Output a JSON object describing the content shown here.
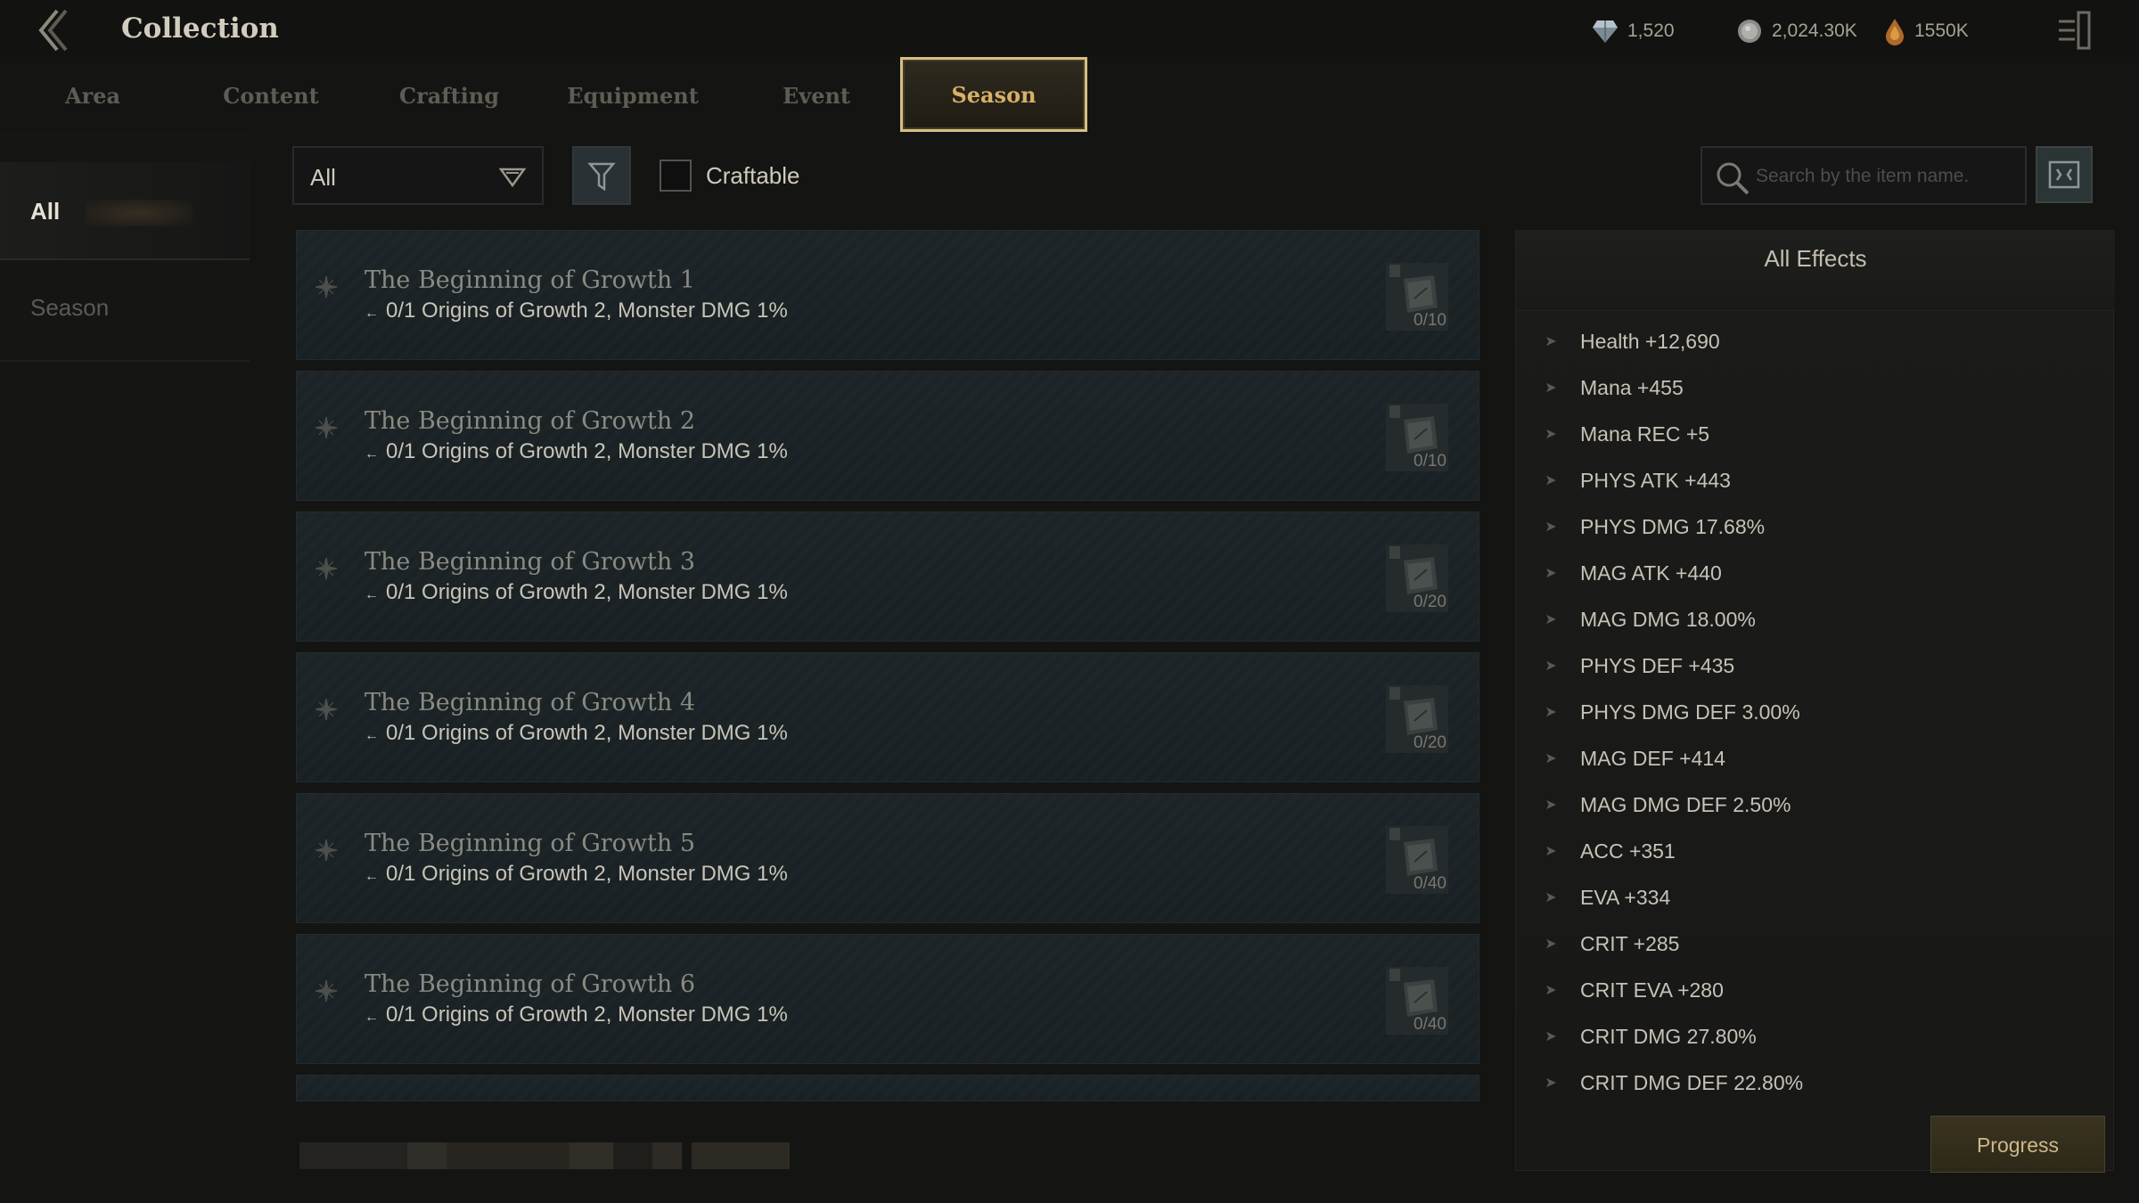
{
  "header": {
    "title": "Collection",
    "back_icon": "back-chevron-icon",
    "menu_icon": "exit-menu-icon"
  },
  "currencies": [
    {
      "icon": "diamond-icon",
      "value": "1,520"
    },
    {
      "icon": "silver-coin-icon",
      "value": "2,024.30K"
    },
    {
      "icon": "gold-drop-icon",
      "value": "1550K"
    }
  ],
  "tabs": [
    {
      "label": "Area",
      "active": false
    },
    {
      "label": "Content",
      "active": false
    },
    {
      "label": "Crafting",
      "active": false
    },
    {
      "label": "Equipment",
      "active": false
    },
    {
      "label": "Event",
      "active": false
    },
    {
      "label": "Season",
      "active": true
    }
  ],
  "sidebar": {
    "items": [
      {
        "label": "All",
        "active": true
      },
      {
        "label": "Season",
        "active": false
      }
    ]
  },
  "filters": {
    "dropdown_value": "All",
    "craftable_label": "Craftable",
    "craftable_checked": false,
    "search_placeholder": "Search by the item name."
  },
  "collections": [
    {
      "name": "The Beginning of Growth 1",
      "requirement": "0/1 Origins of Growth 2, Monster DMG 1%",
      "count": "0/10"
    },
    {
      "name": "The Beginning of Growth 2",
      "requirement": "0/1 Origins of Growth 2, Monster DMG 1%",
      "count": "0/10"
    },
    {
      "name": "The Beginning of Growth 3",
      "requirement": "0/1 Origins of Growth 2, Monster DMG 1%",
      "count": "0/20"
    },
    {
      "name": "The Beginning of Growth 4",
      "requirement": "0/1 Origins of Growth 2, Monster DMG 1%",
      "count": "0/20"
    },
    {
      "name": "The Beginning of Growth 5",
      "requirement": "0/1 Origins of Growth 2, Monster DMG 1%",
      "count": "0/40"
    },
    {
      "name": "The Beginning of Growth 6",
      "requirement": "0/1 Origins of Growth 2, Monster DMG 1%",
      "count": "0/40"
    }
  ],
  "effects": {
    "title": "All Effects",
    "items": [
      "Health +12,690",
      "Mana +455",
      "Mana REC +5",
      "PHYS ATK +443",
      "PHYS DMG 17.68%",
      "MAG ATK +440",
      "MAG DMG 18.00%",
      "PHYS DEF +435",
      "PHYS DMG DEF 3.00%",
      "MAG DEF +414",
      "MAG DMG DEF 2.50%",
      "ACC +351",
      "EVA +334",
      "CRIT +285",
      "CRIT EVA +280",
      "CRIT DMG 27.80%",
      "CRIT DMG DEF 22.80%"
    ]
  },
  "progress_button": "Progress",
  "colors": {
    "accent_gold": "#d6bf83",
    "tab_active_text": "#d8b067",
    "row_bg": "#1a2225"
  }
}
